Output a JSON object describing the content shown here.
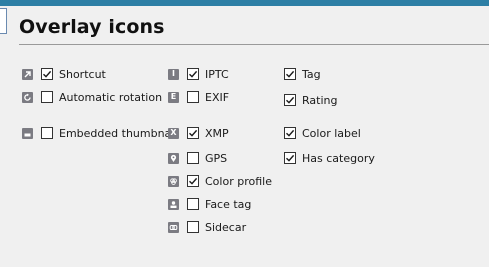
{
  "title": "Overlay icons",
  "columns": [
    {
      "items": [
        {
          "id": "shortcut",
          "label": "Shortcut",
          "checked": true,
          "icon": "arrow-icon"
        },
        {
          "id": "automatic-rotation",
          "label": "Automatic rotation",
          "checked": false,
          "icon": "rotation-icon"
        },
        {
          "id": "embedded-thumbnail",
          "label": "Embedded thumbnail",
          "checked": false,
          "icon": "thumbnail-icon"
        }
      ]
    },
    {
      "items": [
        {
          "id": "iptc",
          "label": "IPTC",
          "checked": true,
          "icon": "iptc-icon",
          "glyph": "I"
        },
        {
          "id": "exif",
          "label": "EXIF",
          "checked": false,
          "icon": "exif-icon",
          "glyph": "E"
        },
        {
          "id": "xmp",
          "label": "XMP",
          "checked": true,
          "icon": "xmp-icon",
          "glyph": "X"
        },
        {
          "id": "gps",
          "label": "GPS",
          "checked": false,
          "icon": "gps-pin-icon"
        },
        {
          "id": "color-profile",
          "label": "Color profile",
          "checked": true,
          "icon": "color-profile-icon"
        },
        {
          "id": "face-tag",
          "label": "Face tag",
          "checked": false,
          "icon": "face-tag-icon"
        },
        {
          "id": "sidecar",
          "label": "Sidecar",
          "checked": false,
          "icon": "sidecar-icon"
        }
      ]
    },
    {
      "items": [
        {
          "id": "tag",
          "label": "Tag",
          "checked": true
        },
        {
          "id": "rating",
          "label": "Rating",
          "checked": true
        },
        {
          "id": "color-label",
          "label": "Color label",
          "checked": true
        },
        {
          "id": "has-category",
          "label": "Has category",
          "checked": true
        }
      ]
    }
  ]
}
